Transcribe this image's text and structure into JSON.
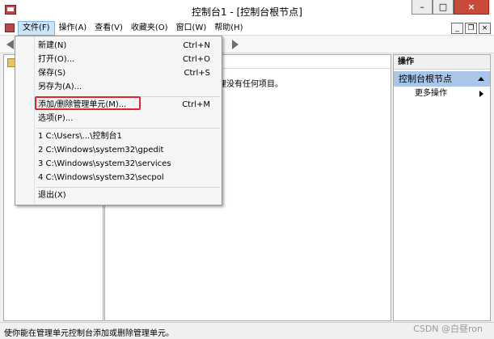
{
  "window": {
    "title": "控制台1 - [控制台根节点]",
    "caption_buttons": [
      "–",
      "□",
      "×"
    ],
    "mdi_buttons": [
      "_",
      "❐",
      "×"
    ]
  },
  "menubar": {
    "items": [
      "文件(F)",
      "操作(A)",
      "查看(V)",
      "收藏夹(O)",
      "窗口(W)",
      "帮助(H)"
    ]
  },
  "file_menu": {
    "items": [
      {
        "label": "新建(N)",
        "shortcut": "Ctrl+N"
      },
      {
        "label": "打开(O)...",
        "shortcut": "Ctrl+O"
      },
      {
        "label": "保存(S)",
        "shortcut": "Ctrl+S"
      },
      {
        "label": "另存为(A)...",
        "shortcut": ""
      },
      {
        "label": "添加/删除管理单元(M)...",
        "shortcut": "Ctrl+M"
      },
      {
        "label": "选项(P)...",
        "shortcut": ""
      },
      {
        "label": "1 C:\\Users\\...\\控制台1",
        "shortcut": ""
      },
      {
        "label": "2 C:\\Windows\\system32\\gpedit",
        "shortcut": ""
      },
      {
        "label": "3 C:\\Windows\\system32\\services",
        "shortcut": ""
      },
      {
        "label": "4 C:\\Windows\\system32\\secpol",
        "shortcut": ""
      },
      {
        "label": "退出(X)",
        "shortcut": ""
      }
    ],
    "highlight_color": "#e0262c"
  },
  "center": {
    "empty_text": "理没有任何项目。"
  },
  "actions_pane": {
    "header": "操作",
    "group": "控制台根节点",
    "more": "更多操作"
  },
  "statusbar": {
    "text": "使你能在管理单元控制台添加或删除管理单元。"
  },
  "watermark": "CSDN @白昼ron",
  "colors": {
    "actions_group_bg": "#a9c6e8",
    "menu_active_bg": "#cce4f7"
  }
}
